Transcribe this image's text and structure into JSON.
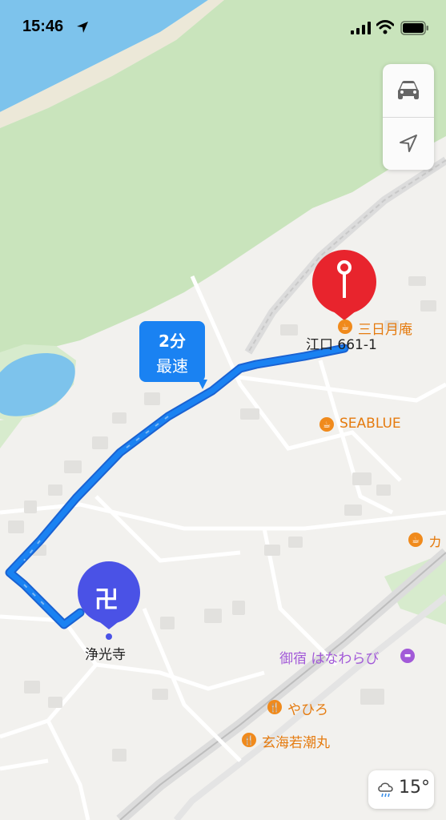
{
  "status_bar": {
    "time": "15:46"
  },
  "route_callout": {
    "duration": "2分",
    "label": "最速"
  },
  "destination": {
    "address": "江口 661-1"
  },
  "origin": {
    "icon": "卍",
    "name": "浄光寺"
  },
  "pois": [
    {
      "name": "三日月庵",
      "category": "cafe"
    },
    {
      "name": "SEABLUE",
      "category": "cafe"
    },
    {
      "name": "カ",
      "category": "cafe"
    },
    {
      "name": "御宿 はなわらび",
      "category": "lodging"
    },
    {
      "name": "やひろ",
      "category": "restaurant"
    },
    {
      "name": "玄海若潮丸",
      "category": "restaurant"
    }
  ],
  "map_controls": [
    "car-icon",
    "location-arrow-icon"
  ],
  "weather": {
    "temp": "15°",
    "icon": "cloud-rain-icon"
  },
  "colors": {
    "route": "#1a82f2",
    "pin_red": "#e8242d",
    "origin_blue": "#4a52e6",
    "poi_orange": "#f08a1c",
    "lodging_purple": "#a25ad8",
    "water": "#7dc3ec",
    "green": "#c9e4bc"
  }
}
